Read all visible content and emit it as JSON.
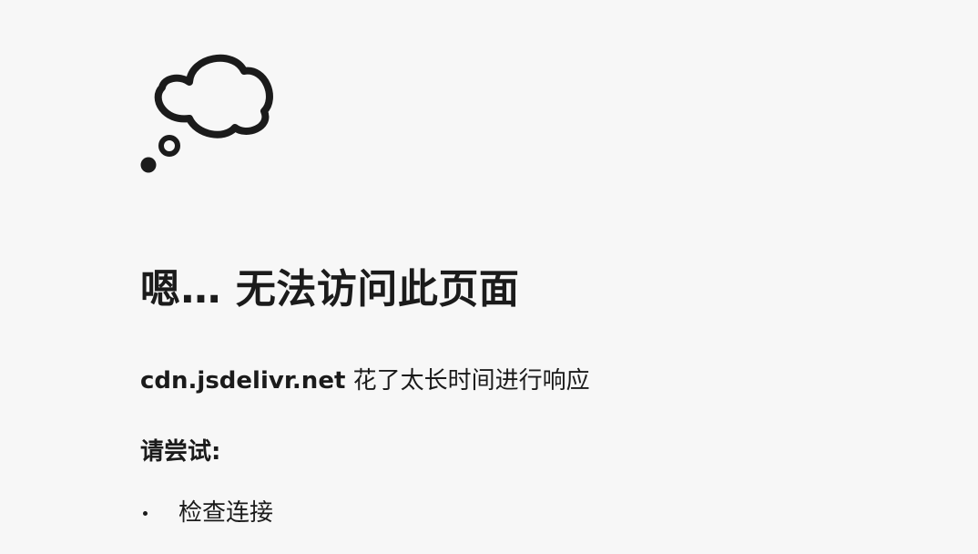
{
  "icon": "thought-cloud-icon",
  "title": "嗯… 无法访问此页面",
  "message": {
    "host": "cdn.jsdelivr.net",
    "text": " 花了太长时间进行响应"
  },
  "try_heading": "请尝试:",
  "suggestions": [
    {
      "label": "检查连接"
    }
  ],
  "colors": {
    "background": "#f7f7f7",
    "text": "#1b1b1b"
  }
}
